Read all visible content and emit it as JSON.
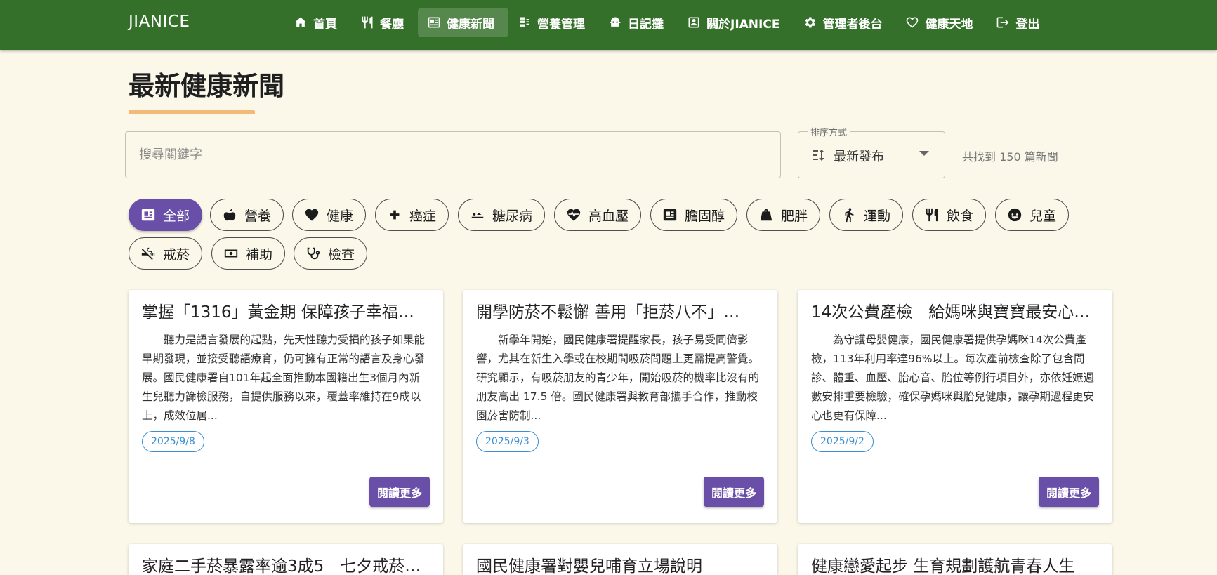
{
  "brand": "JIANICE",
  "nav": [
    {
      "label": "首頁",
      "icon": "home-icon"
    },
    {
      "label": "餐廳",
      "icon": "restaurant-icon"
    },
    {
      "label": "健康新聞",
      "icon": "news-icon",
      "active": true
    },
    {
      "label": "營養管理",
      "icon": "nutrition-icon"
    },
    {
      "label": "日記攤",
      "icon": "diary-icon"
    },
    {
      "label": "關於JIANICE",
      "icon": "info-icon"
    },
    {
      "label": "管理者後台",
      "icon": "gear-icon"
    },
    {
      "label": "健康天地",
      "icon": "heart-health-icon"
    },
    {
      "label": "登出",
      "icon": "logout-icon"
    }
  ],
  "page": {
    "title": "最新健康新聞"
  },
  "search": {
    "placeholder": "搜尋關鍵字",
    "value": ""
  },
  "sort": {
    "label": "排序方式",
    "value": "最新發布"
  },
  "result_count": "共找到 150 篇新聞",
  "chips": [
    {
      "label": "全部",
      "icon": "news-icon",
      "active": true
    },
    {
      "label": "營養",
      "icon": "apple-icon"
    },
    {
      "label": "健康",
      "icon": "heart-icon"
    },
    {
      "label": "癌症",
      "icon": "plus-icon"
    },
    {
      "label": "糖尿病",
      "icon": "diabetes-icon"
    },
    {
      "label": "高血壓",
      "icon": "heartbeat-icon"
    },
    {
      "label": "膽固醇",
      "icon": "cholesterol-icon"
    },
    {
      "label": "肥胖",
      "icon": "weight-icon"
    },
    {
      "label": "運動",
      "icon": "running-icon"
    },
    {
      "label": "飲食",
      "icon": "utensils-icon"
    },
    {
      "label": "兒童",
      "icon": "child-icon"
    },
    {
      "label": "戒菸",
      "icon": "no-smoking-icon"
    },
    {
      "label": "補助",
      "icon": "money-icon"
    },
    {
      "label": "檢查",
      "icon": "stethoscope-icon"
    }
  ],
  "cards": [
    {
      "title": "掌握「1316」黃金期 保障孩子幸福…",
      "excerpt": "聽力是語言發展的起點，先天性聽力受損的孩子如果能早期發現，並接受聽語療育，仍可擁有正常的語言及身心發展。國民健康署自101年起全面推動本國籍出生3個月內新生兒聽力篩檢服務，自提供服務以來，覆蓋率維持在9成以上，成效位居...",
      "date": "2025/9/8",
      "button": "閱讀更多"
    },
    {
      "title": "開學防菸不鬆懈 善用「拒菸八不」…",
      "excerpt": "新學年開始，國民健康署提醒家長，孩子易受同儕影響，尤其在新生入學或在校期間吸菸問題上更需提高警覺。研究顯示，有吸菸朋友的青少年，開始吸菸的機率比沒有的朋友高出 17.5 倍。國民健康署與教育部攜手合作，推動校園菸害防制...",
      "date": "2025/9/3",
      "button": "閱讀更多"
    },
    {
      "title": "14次公費產檢　給媽咪與寶寶最安心…",
      "excerpt": "為守護母嬰健康，國民健康署提供孕媽咪14次公費產檢，113年利用率達96%以上。每次產前檢查除了包含問診、體重、血壓、胎心音、胎位等例行項目外，亦依妊娠週數安排重要檢驗，確保孕媽咪與胎兒健康，讓孕期過程更安心也更有保障...",
      "date": "2025/9/2",
      "button": "閱讀更多"
    }
  ],
  "next_cards": [
    {
      "title": "家庭二手菸暴露率逾3成5　七夕戒菸…"
    },
    {
      "title": "國民健康署對嬰兒哺育立場說明"
    },
    {
      "title": "健康戀愛起步 生育規劃護航青春人生"
    }
  ]
}
